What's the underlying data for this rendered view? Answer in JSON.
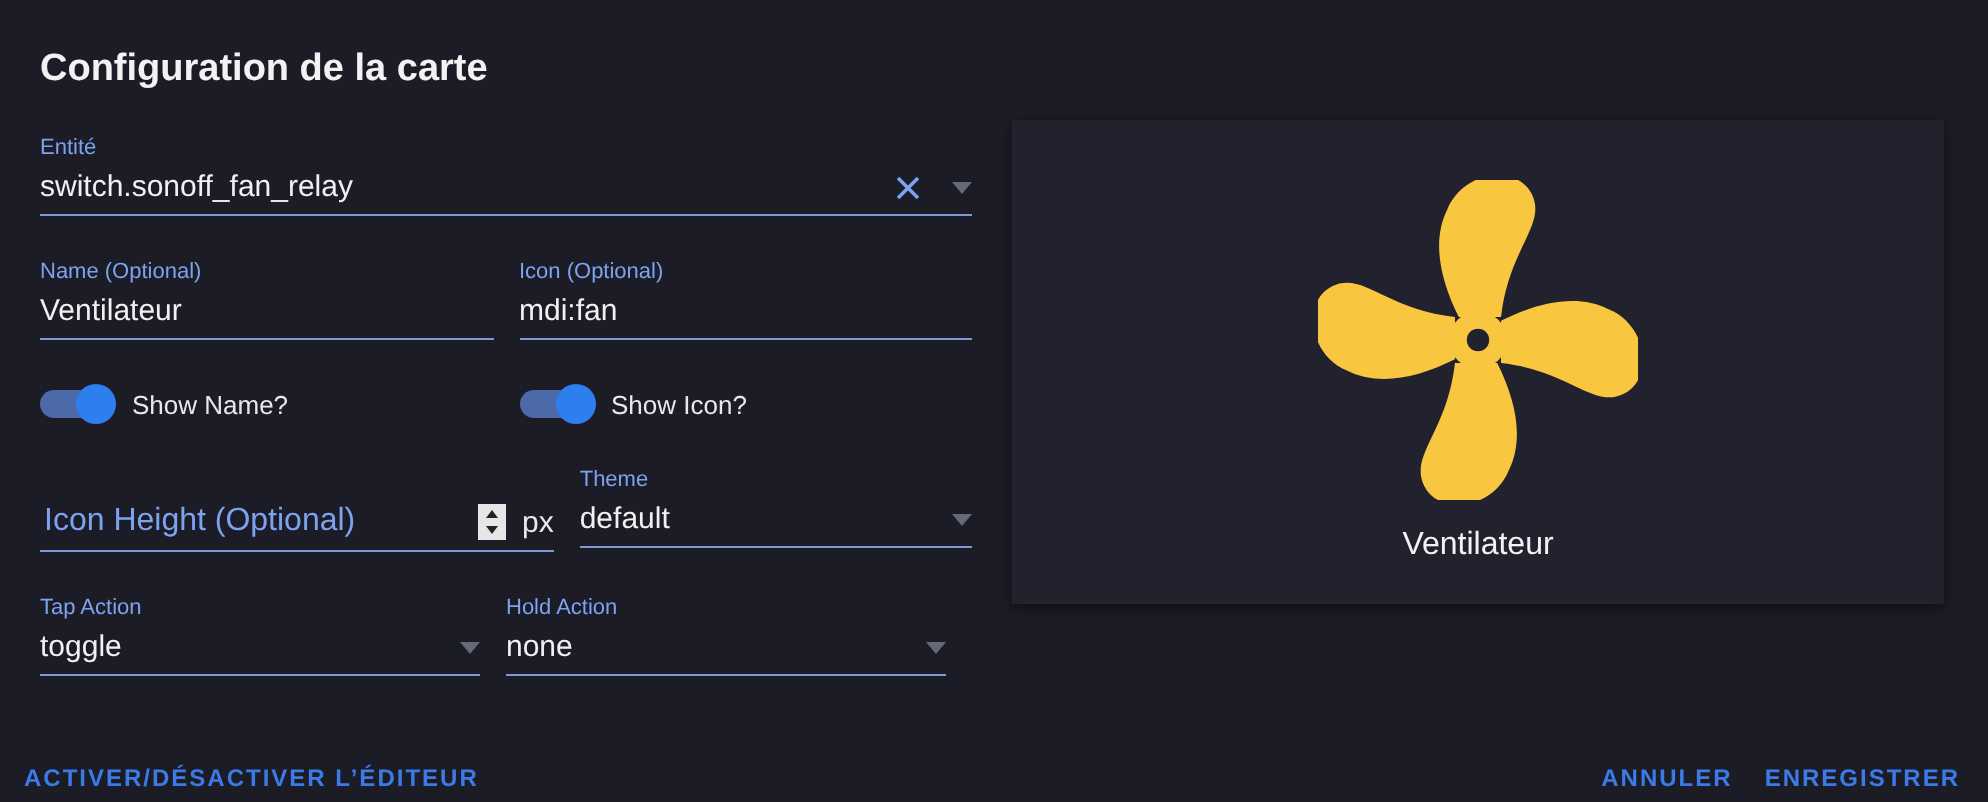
{
  "dialog": {
    "title": "Configuration de la carte"
  },
  "entity": {
    "label": "Entité",
    "value": "switch.sonoff_fan_relay"
  },
  "rows": [
    [
      {
        "kind": "text",
        "label": "Name (Optional)",
        "value": "Ventilateur"
      },
      {
        "kind": "text",
        "label": "Icon (Optional)",
        "value": "mdi:fan"
      }
    ],
    [
      {
        "kind": "toggle",
        "label": "Show Name?",
        "on": true
      },
      {
        "kind": "toggle",
        "label": "Show Icon?",
        "on": true
      }
    ],
    [
      {
        "kind": "number",
        "placeholder": "Icon Height (Optional)",
        "unit": "px"
      },
      {
        "kind": "select",
        "label": "Theme",
        "value": "default"
      }
    ],
    [
      {
        "kind": "select",
        "label": "Tap Action",
        "value": "toggle"
      },
      {
        "kind": "select",
        "label": "Hold Action",
        "value": "none"
      }
    ]
  ],
  "preview": {
    "name": "Ventilateur"
  },
  "footer": {
    "left": [
      "ACTIVER/DÉSACTIVER L’ÉDITEUR"
    ],
    "right": [
      "ANNULER",
      "ENREGISTRER"
    ]
  }
}
